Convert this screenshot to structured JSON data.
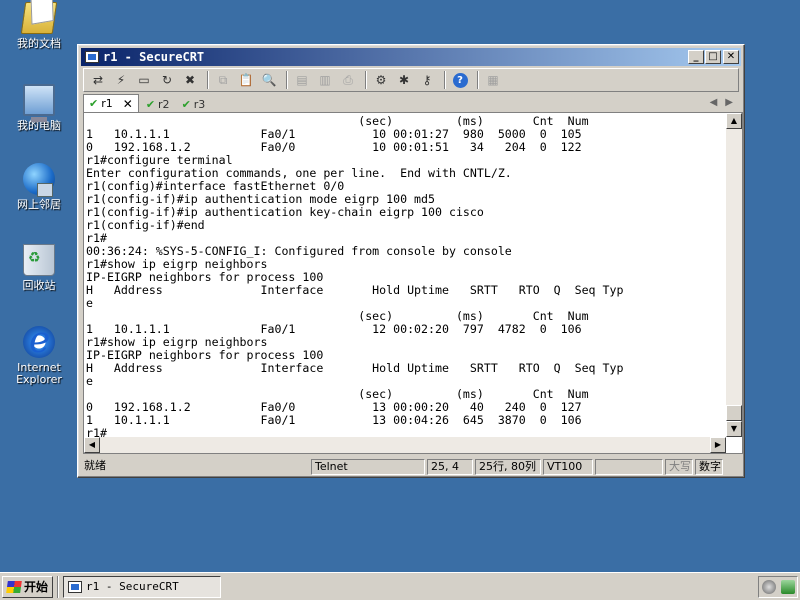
{
  "desktop": {
    "icons": [
      {
        "label": "我的文档",
        "icon": "my-documents-icon"
      },
      {
        "label": "我的电脑",
        "icon": "my-computer-icon"
      },
      {
        "label": "网上邻居",
        "icon": "network-places-icon"
      },
      {
        "label": "回收站",
        "icon": "recycle-bin-icon"
      },
      {
        "label": "Internet Explorer",
        "icon": "internet-explorer-icon"
      }
    ]
  },
  "window": {
    "title": "r1 - SecureCRT",
    "tabs": [
      {
        "label": "r1",
        "active": true
      },
      {
        "label": "r2",
        "active": false
      },
      {
        "label": "r3",
        "active": false
      }
    ],
    "terminal_lines": [
      "                                       (sec)         (ms)       Cnt  Num",
      "1   10.1.1.1             Fa0/1           10 00:01:27  980  5000  0  105",
      "0   192.168.1.2          Fa0/0           10 00:01:51   34   204  0  122",
      "r1#configure terminal",
      "Enter configuration commands, one per line.  End with CNTL/Z.",
      "r1(config)#interface fastEthernet 0/0",
      "r1(config-if)#ip authentication mode eigrp 100 md5",
      "r1(config-if)#ip authentication key-chain eigrp 100 cisco",
      "r1(config-if)#end",
      "r1#",
      "00:36:24: %SYS-5-CONFIG_I: Configured from console by console",
      "r1#show ip eigrp neighbors",
      "IP-EIGRP neighbors for process 100",
      "H   Address              Interface       Hold Uptime   SRTT   RTO  Q  Seq Typ",
      "e",
      "                                       (sec)         (ms)       Cnt  Num",
      "1   10.1.1.1             Fa0/1           12 00:02:20  797  4782  0  106",
      "r1#show ip eigrp neighbors",
      "IP-EIGRP neighbors for process 100",
      "H   Address              Interface       Hold Uptime   SRTT   RTO  Q  Seq Typ",
      "e",
      "                                       (sec)         (ms)       Cnt  Num",
      "0   192.168.1.2          Fa0/0           13 00:00:20   40   240  0  127",
      "1   10.1.1.1             Fa0/1           13 00:04:26  645  3870  0  106",
      "r1#"
    ],
    "status": {
      "ready": "就绪",
      "protocol": "Telnet",
      "cursor": "25, 4",
      "size": "25行, 80列",
      "emulation": "VT100",
      "caps": "大写",
      "num": "数字"
    }
  },
  "taskbar": {
    "start_label": "开始",
    "task_label": "r1 - SecureCRT"
  }
}
